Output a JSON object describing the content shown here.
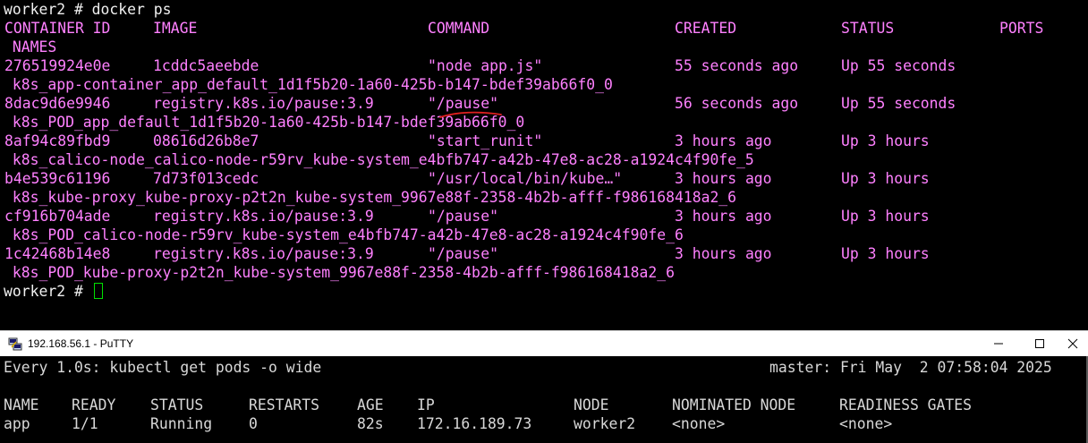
{
  "top_terminal": {
    "prompt_command": "worker2 # docker ps",
    "headers": {
      "container_id": "CONTAINER ID",
      "image": "IMAGE",
      "command": "COMMAND",
      "created": "CREATED",
      "status": "STATUS",
      "ports": "PORTS",
      "names": " NAMES"
    },
    "rows": [
      {
        "id": "276519924e0e",
        "image": "1cddc5aeebde",
        "command": "\"node app.js\"",
        "created": "55 seconds ago",
        "status": "Up 55 seconds",
        "name": " k8s_app-container_app_default_1d1f5b20-1a60-425b-b147-bdef39ab66f0_0"
      },
      {
        "id": "8dac9d6e9946",
        "image": "registry.k8s.io/pause:3.9",
        "command": "\"/pause\"",
        "created": "56 seconds ago",
        "status": "Up 55 seconds",
        "name": " k8s_POD_app_default_1d1f5b20-1a60-425b-b147-bdef39ab66f0_0"
      },
      {
        "id": "8af94c89fbd9",
        "image": "08616d26b8e7",
        "command": "\"start_runit\"",
        "created": "3 hours ago",
        "status": "Up 3 hours",
        "name": " k8s_calico-node_calico-node-r59rv_kube-system_e4bfb747-a42b-47e8-ac28-a1924c4f90fe_5"
      },
      {
        "id": "b4e539c61196",
        "image": "7d73f013cedc",
        "command": "\"/usr/local/bin/kube…\"",
        "created": "3 hours ago",
        "status": "Up 3 hours",
        "name": " k8s_kube-proxy_kube-proxy-p2t2n_kube-system_9967e88f-2358-4b2b-afff-f986168418a2_6"
      },
      {
        "id": "cf916b704ade",
        "image": "registry.k8s.io/pause:3.9",
        "command": "\"/pause\"",
        "created": "3 hours ago",
        "status": "Up 3 hours",
        "name": " k8s_POD_calico-node-r59rv_kube-system_e4bfb747-a42b-47e8-ac28-a1924c4f90fe_6"
      },
      {
        "id": "1c42468b14e8",
        "image": "registry.k8s.io/pause:3.9",
        "command": "\"/pause\"",
        "created": "3 hours ago",
        "status": "Up 3 hours",
        "name": " k8s_POD_kube-proxy-p2t2n_kube-system_9967e88f-2358-4b2b-afff-f986168418a2_6"
      }
    ],
    "final_prompt": "worker2 # "
  },
  "window": {
    "title": "192.168.56.1 - PuTTY",
    "icon": "putty-icon",
    "controls": [
      "minimize-icon",
      "maximize-icon",
      "close-icon"
    ]
  },
  "bottom_terminal": {
    "watch_line": "Every 1.0s: kubectl get pods -o wide",
    "host_time": "master: Fri May  2 07:58:04 2025",
    "headers": {
      "name": "NAME",
      "ready": "READY",
      "status": "STATUS",
      "restarts": "RESTARTS",
      "age": "AGE",
      "ip": "IP",
      "node": "NODE",
      "nominated": "NOMINATED NODE",
      "readiness": "READINESS GATES"
    },
    "rows": [
      {
        "name": "app",
        "ready": "1/1",
        "status": "Running",
        "restarts": "0",
        "age": "82s",
        "ip": "172.16.189.73",
        "node": "worker2",
        "nominated": "<none>",
        "readiness": "<none>"
      }
    ]
  },
  "colors": {
    "terminal_bg": "#000000",
    "output_text": "#ff80ff",
    "prompt_text": "#f0f0f0",
    "cursor": "#00e000",
    "annotation": "#e02020"
  }
}
